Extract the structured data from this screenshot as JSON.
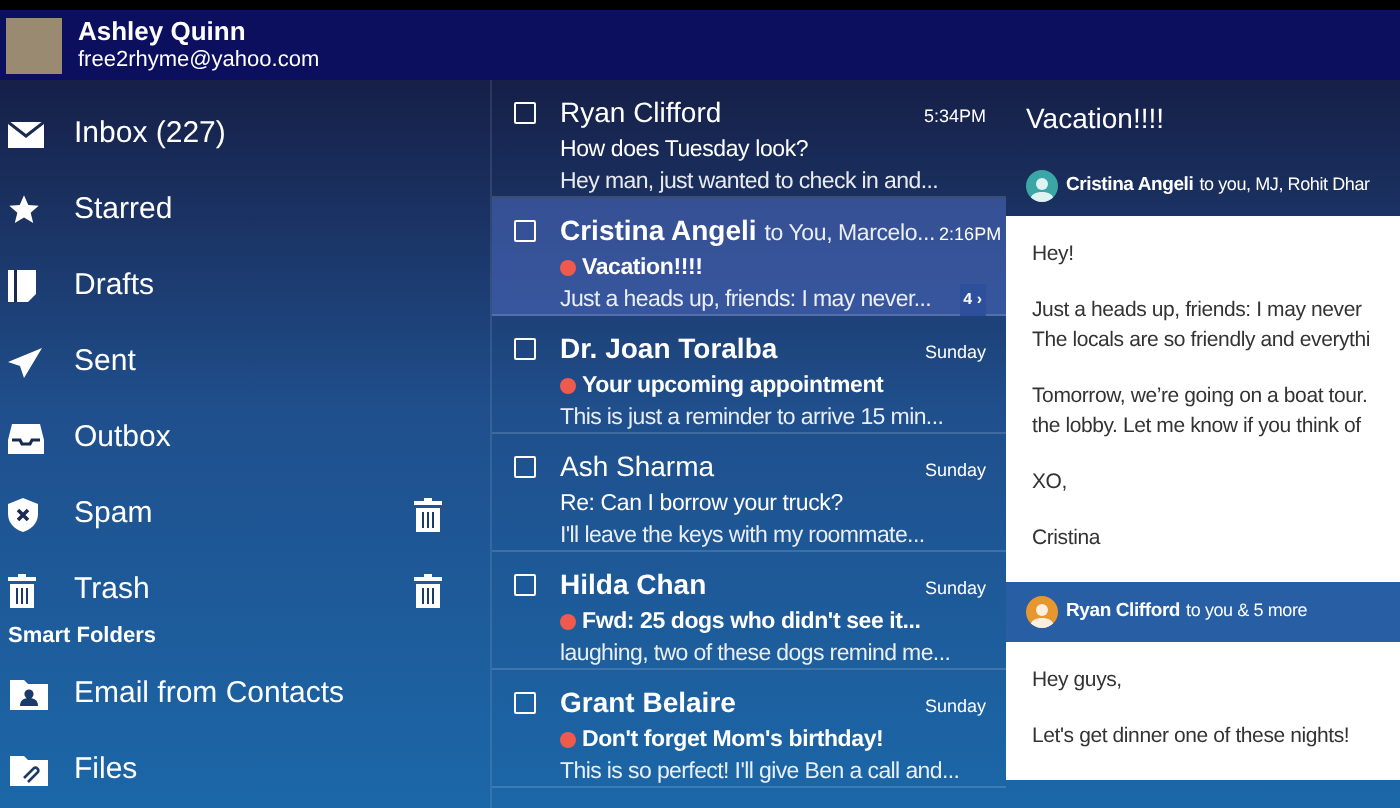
{
  "account": {
    "name": "Ashley Quinn",
    "email": "free2rhyme@yahoo.com"
  },
  "folders": [
    {
      "kind": "inbox",
      "label": "Inbox (227)",
      "empty_action": false,
      "selected": false
    },
    {
      "kind": "starred",
      "label": "Starred",
      "empty_action": false,
      "selected": false
    },
    {
      "kind": "drafts",
      "label": "Drafts",
      "empty_action": false,
      "selected": false
    },
    {
      "kind": "sent",
      "label": "Sent",
      "empty_action": false,
      "selected": false
    },
    {
      "kind": "outbox",
      "label": "Outbox",
      "empty_action": false,
      "selected": false
    },
    {
      "kind": "spam",
      "label": "Spam",
      "empty_action": true,
      "selected": false
    },
    {
      "kind": "trash",
      "label": "Trash",
      "empty_action": true,
      "selected": false
    }
  ],
  "smart_folders": {
    "heading": "Smart Folders",
    "items": [
      {
        "kind": "contacts",
        "label": "Email from Contacts"
      },
      {
        "kind": "files",
        "label": "Files"
      }
    ]
  },
  "messages": [
    {
      "sender": "Ryan Clifford",
      "time": "5:34PM",
      "subject": "How does Tuesday look?",
      "snippet": "Hey man, just wanted to check in and...",
      "unread": false,
      "flagged": false,
      "selected": false,
      "checked": false
    },
    {
      "sender": "Cristina Angeli",
      "recipients": "to You, Marcelo...",
      "time": "2:16PM",
      "subject": "Vacation!!!!",
      "snippet": "Just a heads up, friends: I may never...",
      "thread_count": "4 ›",
      "unread": true,
      "flagged": true,
      "selected": true,
      "checked": false
    },
    {
      "sender": "Dr. Joan Toralba",
      "time": "Sunday",
      "subject": "Your upcoming appointment",
      "snippet": "This is just a reminder to arrive 15 min...",
      "unread": true,
      "flagged": true,
      "selected": false,
      "checked": false
    },
    {
      "sender": "Ash Sharma",
      "time": "Sunday",
      "subject": "Re: Can I borrow your truck?",
      "snippet": "I'll leave the keys with my roommate...",
      "unread": false,
      "flagged": false,
      "selected": false,
      "checked": false
    },
    {
      "sender": "Hilda Chan",
      "time": "Sunday",
      "subject": "Fwd: 25 dogs who didn't see it...",
      "snippet": "laughing, two of these dogs remind me...",
      "unread": true,
      "flagged": true,
      "selected": false,
      "checked": false
    },
    {
      "sender": "Grant Belaire",
      "time": "Sunday",
      "subject": "Don't forget Mom's birthday!",
      "snippet": "This is so perfect!  I'll give Ben a call and...",
      "unread": true,
      "flagged": true,
      "selected": false,
      "checked": false
    }
  ],
  "conversation": {
    "title": "Vacation!!!!",
    "messages": [
      {
        "sender": "Cristina Angeli",
        "recipients": "to you, MJ, Rohit Dhar",
        "color": "#3aa6a6",
        "body": [
          [
            "Hey!"
          ],
          [
            "Just a heads up, friends: I may never",
            "The locals are so friendly and everythi"
          ],
          [
            "Tomorrow, we’re going on a boat tour.",
            "the lobby. Let me know if you think of"
          ],
          [
            "XO,"
          ],
          [
            "Cristina"
          ]
        ]
      },
      {
        "sender": "Ryan Clifford",
        "recipients": "to you & 5 more",
        "color": "#e8962e",
        "body": [
          [
            "Hey guys,"
          ],
          [
            "Let's get dinner one of these nights!"
          ]
        ]
      }
    ]
  }
}
